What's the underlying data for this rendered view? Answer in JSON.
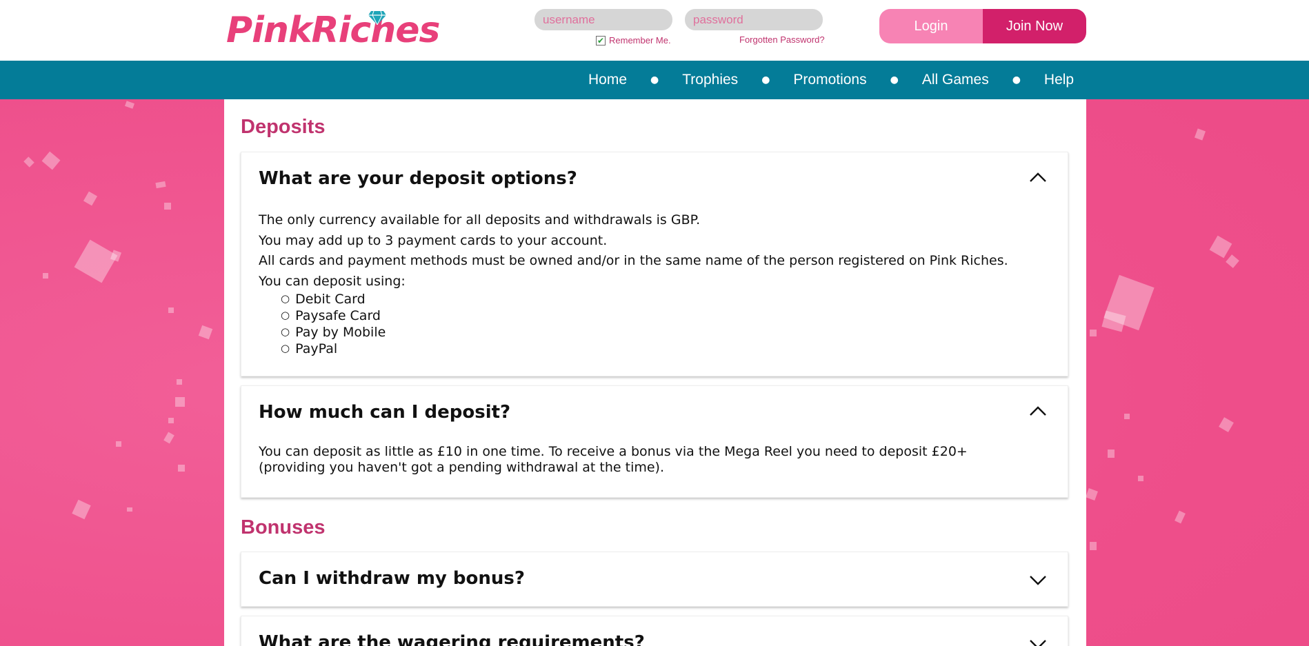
{
  "brand": {
    "logo_text": "PinkRiches",
    "gem_icon": "diamond-icon",
    "colors": {
      "primary": "#e8407a",
      "accent": "#d2206a",
      "nav": "#047c98"
    }
  },
  "login": {
    "username_placeholder": "username",
    "password_placeholder": "password",
    "remember_label": "Remember Me.",
    "remember_checked": true,
    "forgot_label": "Forgotten Password?",
    "login_label": "Login",
    "join_label": "Join Now"
  },
  "nav": {
    "items": [
      {
        "label": "Home"
      },
      {
        "label": "Trophies"
      },
      {
        "label": "Promotions"
      },
      {
        "label": "All Games"
      },
      {
        "label": "Help"
      }
    ]
  },
  "sections": {
    "deposits": {
      "title": "Deposits",
      "faqs": [
        {
          "question": "What are your deposit options?",
          "expanded": true,
          "lines": [
            "The only currency available for all deposits and withdrawals is GBP.",
            "You may add up to 3 payment cards to your account.",
            "All cards and payment methods must be owned and/or in the same name of the person registered on Pink Riches.",
            "You can deposit using:"
          ],
          "list": [
            "Debit Card",
            "Paysafe Card",
            "Pay by Mobile",
            "PayPal"
          ]
        },
        {
          "question": "How much can I deposit?",
          "expanded": true,
          "lines": [
            "You can deposit as little as £10 in one time. To receive a bonus via the Mega Reel you need to deposit £20+",
            "(providing you haven't got a pending withdrawal at the time)."
          ]
        }
      ]
    },
    "bonuses": {
      "title": "Bonuses",
      "faqs": [
        {
          "question": "Can I withdraw my bonus?",
          "expanded": false
        },
        {
          "question": "What are the wagering requirements?",
          "expanded": false
        }
      ]
    }
  }
}
